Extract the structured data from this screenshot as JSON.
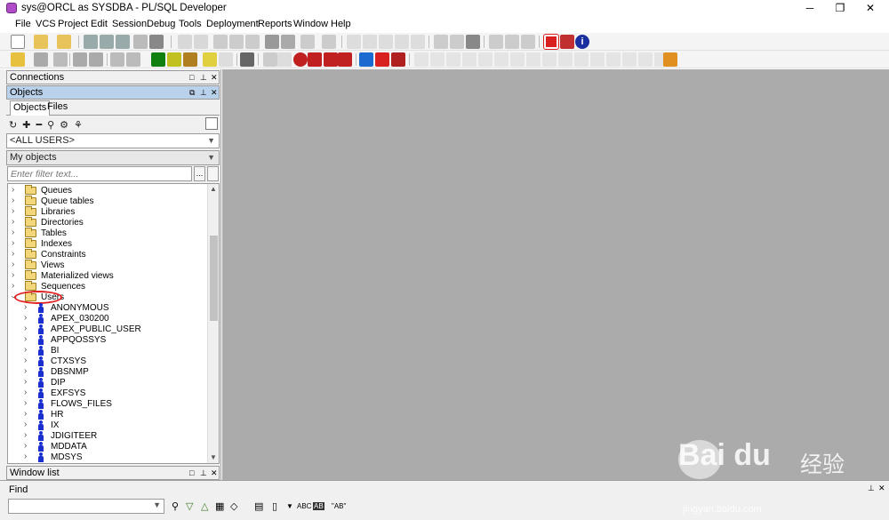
{
  "window": {
    "title": "sys@ORCL as SYSDBA - PL/SQL Developer",
    "minimize_glyph": "─",
    "restore_glyph": "❐",
    "close_glyph": "✕"
  },
  "menu": [
    "File",
    "VCS",
    "Project",
    "Edit",
    "Session",
    "Debug",
    "Tools",
    "Deployment",
    "Reports",
    "Window",
    "Help"
  ],
  "panels": {
    "connections_title": "Connections",
    "objects_title": "Objects",
    "tabs": [
      "Objects",
      "Files"
    ],
    "user_filter": "<ALL USERS>",
    "object_filter": "My objects",
    "filter_placeholder": "Enter filter text...",
    "filter_button": "...",
    "window_list_title": "Window list",
    "find_title": "Find"
  },
  "tree": {
    "folders": [
      "Queues",
      "Queue tables",
      "Libraries",
      "Directories",
      "Tables",
      "Indexes",
      "Constraints",
      "Views",
      "Materialized views",
      "Sequences",
      "Users"
    ],
    "users": [
      "ANONYMOUS",
      "APEX_030200",
      "APEX_PUBLIC_USER",
      "APPQOSSYS",
      "BI",
      "CTXSYS",
      "DBSNMP",
      "DIP",
      "EXFSYS",
      "FLOWS_FILES",
      "HR",
      "IX",
      "JDIGITEER",
      "MDDATA",
      "MDSYS"
    ]
  },
  "findbar": {
    "tool_abc": "ABC",
    "tool_ab": "AB",
    "tool_ab_quoted": "\"AB\""
  },
  "watermark": {
    "brand": "Bai du",
    "cn": "经验",
    "url": "jingyan.baidu.com"
  },
  "colors": {
    "mdi_background": "#ababab",
    "user_icon": "#1a2fd0",
    "highlight_circle": "#e02020"
  }
}
